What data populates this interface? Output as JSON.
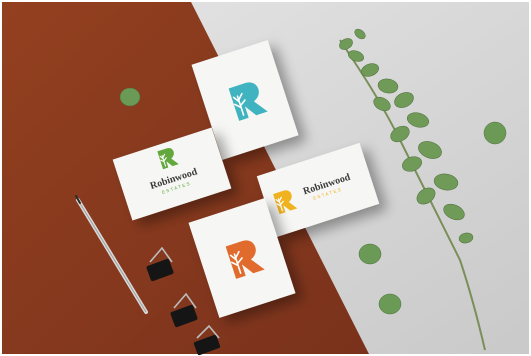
{
  "brand": {
    "logo_letter": "R",
    "name": "Robinwood",
    "tagline": "ESTATES"
  },
  "colors": {
    "background_terracotta": "#8e3b22",
    "background_grey": "#d7d7d7",
    "card": "#f6f6f4",
    "logo_teal": "#3fb3bf",
    "logo_green": "#63a83c",
    "logo_yellow": "#f0b21f",
    "logo_orange": "#e06b2c",
    "text_dark": "#3a3a3a",
    "leaf_green": "#5f8a4c"
  },
  "cards": [
    {
      "id": "teal-logo-card",
      "logo_color": "logo_teal",
      "has_wordmark": false
    },
    {
      "id": "green-wordmark-card",
      "logo_color": "logo_green",
      "has_wordmark": true
    },
    {
      "id": "yellow-wordmark-card",
      "logo_color": "logo_yellow",
      "has_wordmark": true
    },
    {
      "id": "orange-logo-card",
      "logo_color": "logo_orange",
      "has_wordmark": false
    }
  ],
  "props": [
    "pencil",
    "binder-clip",
    "binder-clip",
    "binder-clip",
    "eucalyptus-branch",
    "eucalyptus-leaf"
  ]
}
